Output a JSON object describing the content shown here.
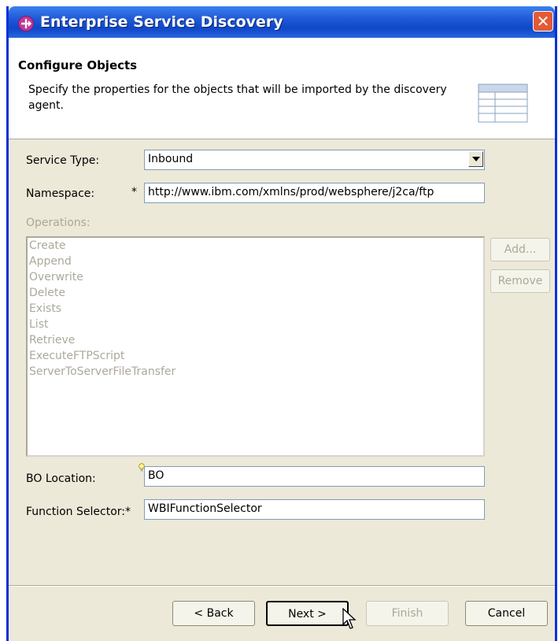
{
  "window": {
    "title": "Enterprise Service Discovery",
    "close_symbol": "✕"
  },
  "header": {
    "title": "Configure Objects",
    "description": "Specify the properties for the objects that will be imported by the discovery agent."
  },
  "form": {
    "service_type": {
      "label": "Service Type:",
      "value": "Inbound"
    },
    "namespace": {
      "label": "Namespace:",
      "required_marker": "*",
      "value": "http://www.ibm.com/xmlns/prod/websphere/j2ca/ftp"
    },
    "operations": {
      "label": "Operations:",
      "items": [
        "Create",
        "Append",
        "Overwrite",
        "Delete",
        "Exists",
        "List",
        "Retrieve",
        "ExecuteFTPScript",
        "ServerToServerFileTransfer"
      ],
      "add_label": "Add...",
      "remove_label": "Remove"
    },
    "bo_location": {
      "label": "BO Location:",
      "value": "BO"
    },
    "function_selector": {
      "label": "Function Selector:*",
      "value": "WBIFunctionSelector"
    }
  },
  "buttons": {
    "back": "< Back",
    "next": "Next >",
    "finish": "Finish",
    "cancel": "Cancel"
  }
}
